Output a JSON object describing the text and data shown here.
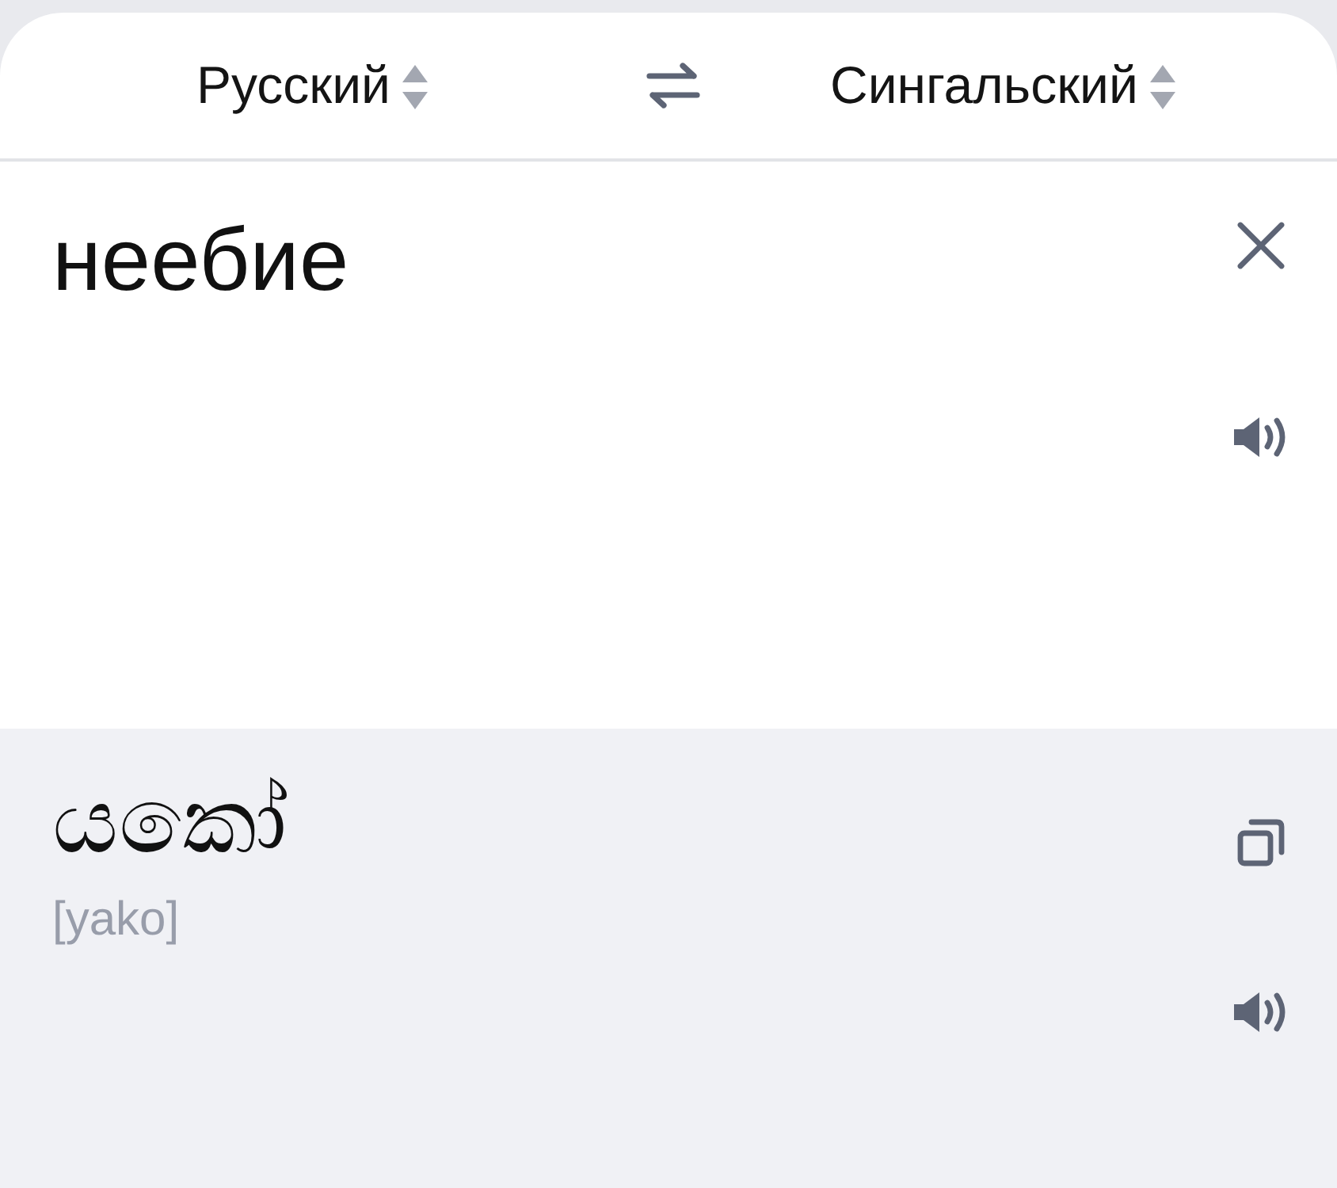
{
  "header": {
    "source_language": "Русский",
    "target_language": "Сингальский"
  },
  "input": {
    "text": "неебие"
  },
  "output": {
    "translation": "යකෝ",
    "transliteration": "[yako]"
  }
}
